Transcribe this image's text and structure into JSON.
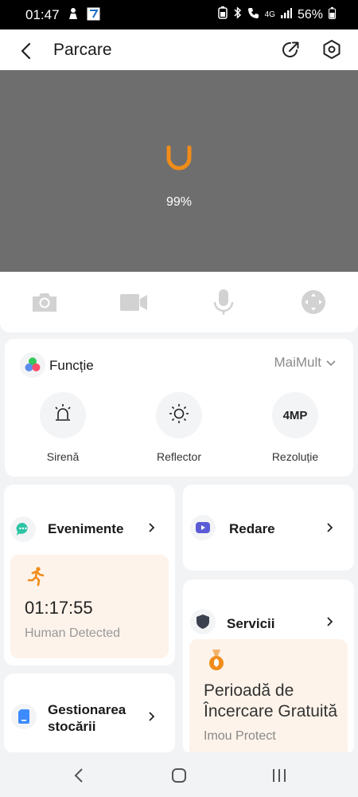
{
  "status_bar": {
    "time": "01:47",
    "battery": "56%",
    "network": "4G"
  },
  "header": {
    "title": "Parcare",
    "back_icon": "chevron-left-icon",
    "share_icon": "share-external-icon",
    "settings_icon": "settings-hexagon-icon"
  },
  "video": {
    "loading_percent": "99%",
    "loader_color": "#f08c1a"
  },
  "controls": {
    "items": [
      "camera-icon",
      "video-record-icon",
      "microphone-icon",
      "ptz-joystick-icon"
    ]
  },
  "functions": {
    "title": "Funcție",
    "more_label": "MaiMult",
    "buttons": [
      {
        "label": "Sirenă",
        "icon": "siren-icon"
      },
      {
        "label": "Reflector",
        "icon": "sun-icon"
      },
      {
        "label": "Rezoluție",
        "icon_text": "4MP"
      }
    ]
  },
  "events": {
    "title": "Evenimente",
    "time": "01:17:55",
    "type": "Human Detected",
    "accent": "#f08c1a"
  },
  "playback": {
    "title": "Redare",
    "accent": "#5b5bd6"
  },
  "services": {
    "title": "Servicii",
    "headline_line1": "Perioadă de",
    "headline_line2": "Încercare Gratuită",
    "subtitle": "Imou Protect"
  },
  "storage": {
    "title_line1": "Gestionarea",
    "title_line2": "stocării",
    "accent": "#3d8bfd"
  }
}
